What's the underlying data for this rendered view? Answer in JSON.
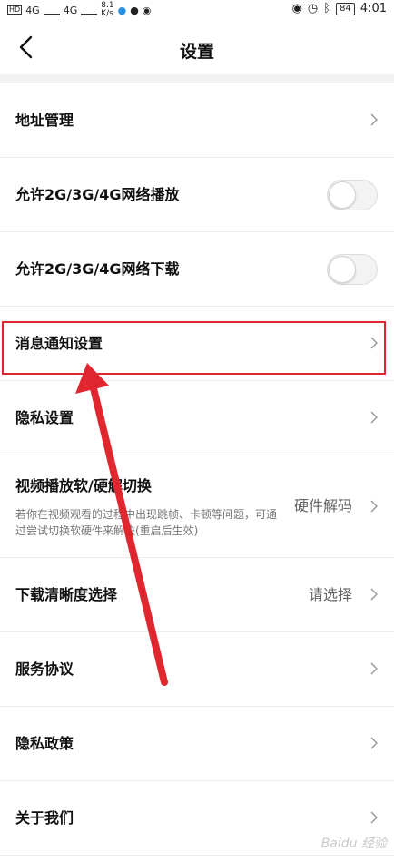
{
  "status_bar": {
    "network_label_1": "4G",
    "network_label_2": "4G",
    "speed_value": "8.1",
    "speed_unit": "K/s",
    "battery": "84",
    "time": "4:01"
  },
  "header": {
    "title": "设置"
  },
  "settings": {
    "address": {
      "label": "地址管理"
    },
    "allow_play": {
      "label": "允许2G/3G/4G网络播放",
      "enabled": false
    },
    "allow_download": {
      "label": "允许2G/3G/4G网络下载",
      "enabled": false
    },
    "notifications": {
      "label": "消息通知设置"
    },
    "privacy_settings": {
      "label": "隐私设置"
    },
    "video_decode": {
      "label": "视频播放软/硬解切换",
      "description": "若你在视频观看的过程中出现跳帧、卡顿等问题，可通过尝试切换软硬件来解决(重启后生效)",
      "value": "硬件解码"
    },
    "download_quality": {
      "label": "下载清晰度选择",
      "value": "请选择"
    },
    "service_agreement": {
      "label": "服务协议"
    },
    "privacy_policy": {
      "label": "隐私政策"
    },
    "about": {
      "label": "关于我们"
    }
  },
  "annotation": {
    "highlight_color": "#e0272f"
  },
  "watermark": "Baidu 经验"
}
